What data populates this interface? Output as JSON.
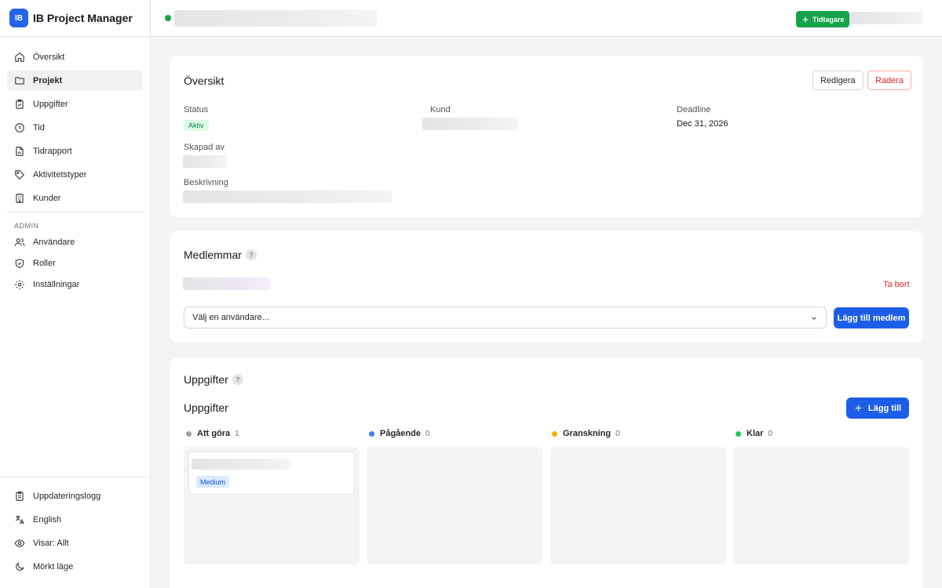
{
  "brand": {
    "logo_text": "IB",
    "name": "IB Project Manager"
  },
  "nav": {
    "items": [
      {
        "label": "Översikt",
        "icon": "home-icon"
      },
      {
        "label": "Projekt",
        "icon": "folder-icon",
        "active": true
      },
      {
        "label": "Uppgifter",
        "icon": "clipboard-icon"
      },
      {
        "label": "Tid",
        "icon": "clock-icon"
      },
      {
        "label": "Tidrapport",
        "icon": "file-icon"
      },
      {
        "label": "Aktivitetstyper",
        "icon": "tag-icon"
      },
      {
        "label": "Kunder",
        "icon": "building-icon"
      }
    ],
    "admin_heading": "ADMIN",
    "admin_items": [
      {
        "label": "Användare",
        "icon": "users-icon"
      },
      {
        "label": "Roller",
        "icon": "shield-icon"
      },
      {
        "label": "Inställningar",
        "icon": "gear-icon"
      }
    ],
    "bottom_items": [
      {
        "label": "Uppdateringslogg",
        "icon": "changelog-icon"
      },
      {
        "label": "English",
        "icon": "language-icon"
      },
      {
        "label": "Visar: Allt",
        "icon": "eye-icon"
      },
      {
        "label": "Mörkt läge",
        "icon": "moon-icon"
      }
    ]
  },
  "header": {
    "timer_label": "Tidtagare"
  },
  "overview": {
    "title": "Översikt",
    "edit_label": "Redigera",
    "delete_label": "Radera",
    "status_label": "Status",
    "status_value": "Aktiv",
    "customer_label": "Kund",
    "deadline_label": "Deadline",
    "deadline_value": "Dec 31, 2026",
    "created_by_label": "Skapad av",
    "description_label": "Beskrivning"
  },
  "members": {
    "title": "Medlemmar",
    "help": "?",
    "remove_label": "Ta bort",
    "select_placeholder": "Välj en användare...",
    "add_label": "Lägg till medlem"
  },
  "tasks": {
    "title": "Uppgifter",
    "help": "?",
    "board_title": "Uppgifter",
    "add_label": "Lägg till",
    "columns": [
      {
        "label": "Att göra",
        "count": "1",
        "color": "#a1a1aa"
      },
      {
        "label": "Pågående",
        "count": "0",
        "color": "#3b82f6"
      },
      {
        "label": "Granskning",
        "count": "0",
        "color": "#eab308"
      },
      {
        "label": "Klar",
        "count": "0",
        "color": "#22c55e"
      }
    ],
    "card_priority": "Medium"
  }
}
